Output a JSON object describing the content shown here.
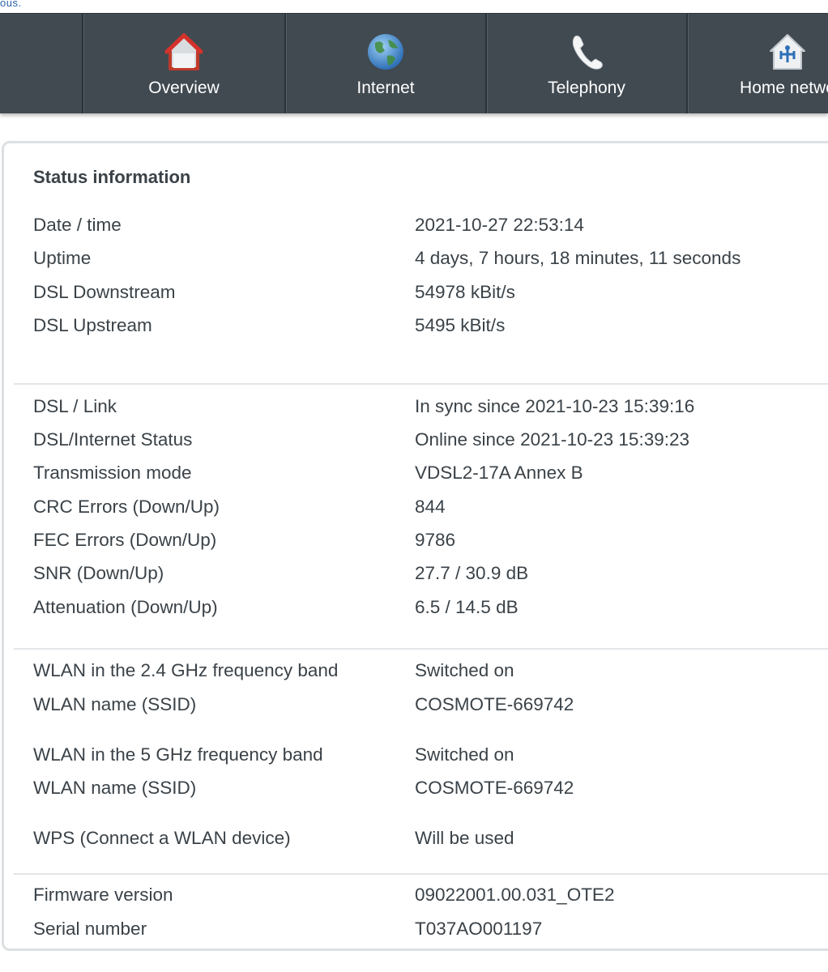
{
  "top_fragment": "ous.",
  "nav": {
    "items": [
      {
        "label": "Overview",
        "icon": "home-icon"
      },
      {
        "label": "Internet",
        "icon": "globe-icon"
      },
      {
        "label": "Telephony",
        "icon": "phone-icon"
      },
      {
        "label": "Home netwo",
        "icon": "home-network-icon"
      }
    ]
  },
  "status": {
    "title": "Status information",
    "group1": [
      {
        "label": "Date / time",
        "value": "2021-10-27 22:53:14"
      },
      {
        "label": "Uptime",
        "value": "4 days, 7 hours, 18 minutes, 11 seconds"
      },
      {
        "label": "DSL Downstream",
        "value": "54978 kBit/s"
      },
      {
        "label": "DSL Upstream",
        "value": "5495 kBit/s"
      }
    ],
    "group2": [
      {
        "label": "DSL / Link",
        "value": "In sync since 2021-10-23 15:39:16"
      },
      {
        "label": "DSL/Internet Status",
        "value": "Online since 2021-10-23 15:39:23"
      },
      {
        "label": "Transmission mode",
        "value": "VDSL2-17A Annex B"
      },
      {
        "label": "CRC Errors (Down/Up)",
        "value": "844"
      },
      {
        "label": "FEC Errors (Down/Up)",
        "value": "9786"
      },
      {
        "label": "SNR (Down/Up)",
        "value": "27.7 / 30.9 dB"
      },
      {
        "label": "Attenuation (Down/Up)",
        "value": "6.5 / 14.5 dB"
      }
    ],
    "group3": [
      {
        "label": "WLAN in the 2.4 GHz frequency band",
        "value": "Switched on"
      },
      {
        "label": "WLAN name (SSID)",
        "value": "COSMOTE-669742"
      },
      {
        "label": "WLAN in the 5 GHz frequency band",
        "value": "Switched on"
      },
      {
        "label": "WLAN name (SSID)",
        "value": "COSMOTE-669742"
      },
      {
        "label": "WPS (Connect a WLAN device)",
        "value": "Will be used"
      }
    ],
    "group4": [
      {
        "label": "Firmware version",
        "value": "09022001.00.031_OTE2"
      },
      {
        "label": "Serial number",
        "value": "T037AO001197"
      }
    ]
  },
  "colors": {
    "nav_bg": "#414a51",
    "text": "#3a4248",
    "panel_border": "#dde0e2"
  }
}
